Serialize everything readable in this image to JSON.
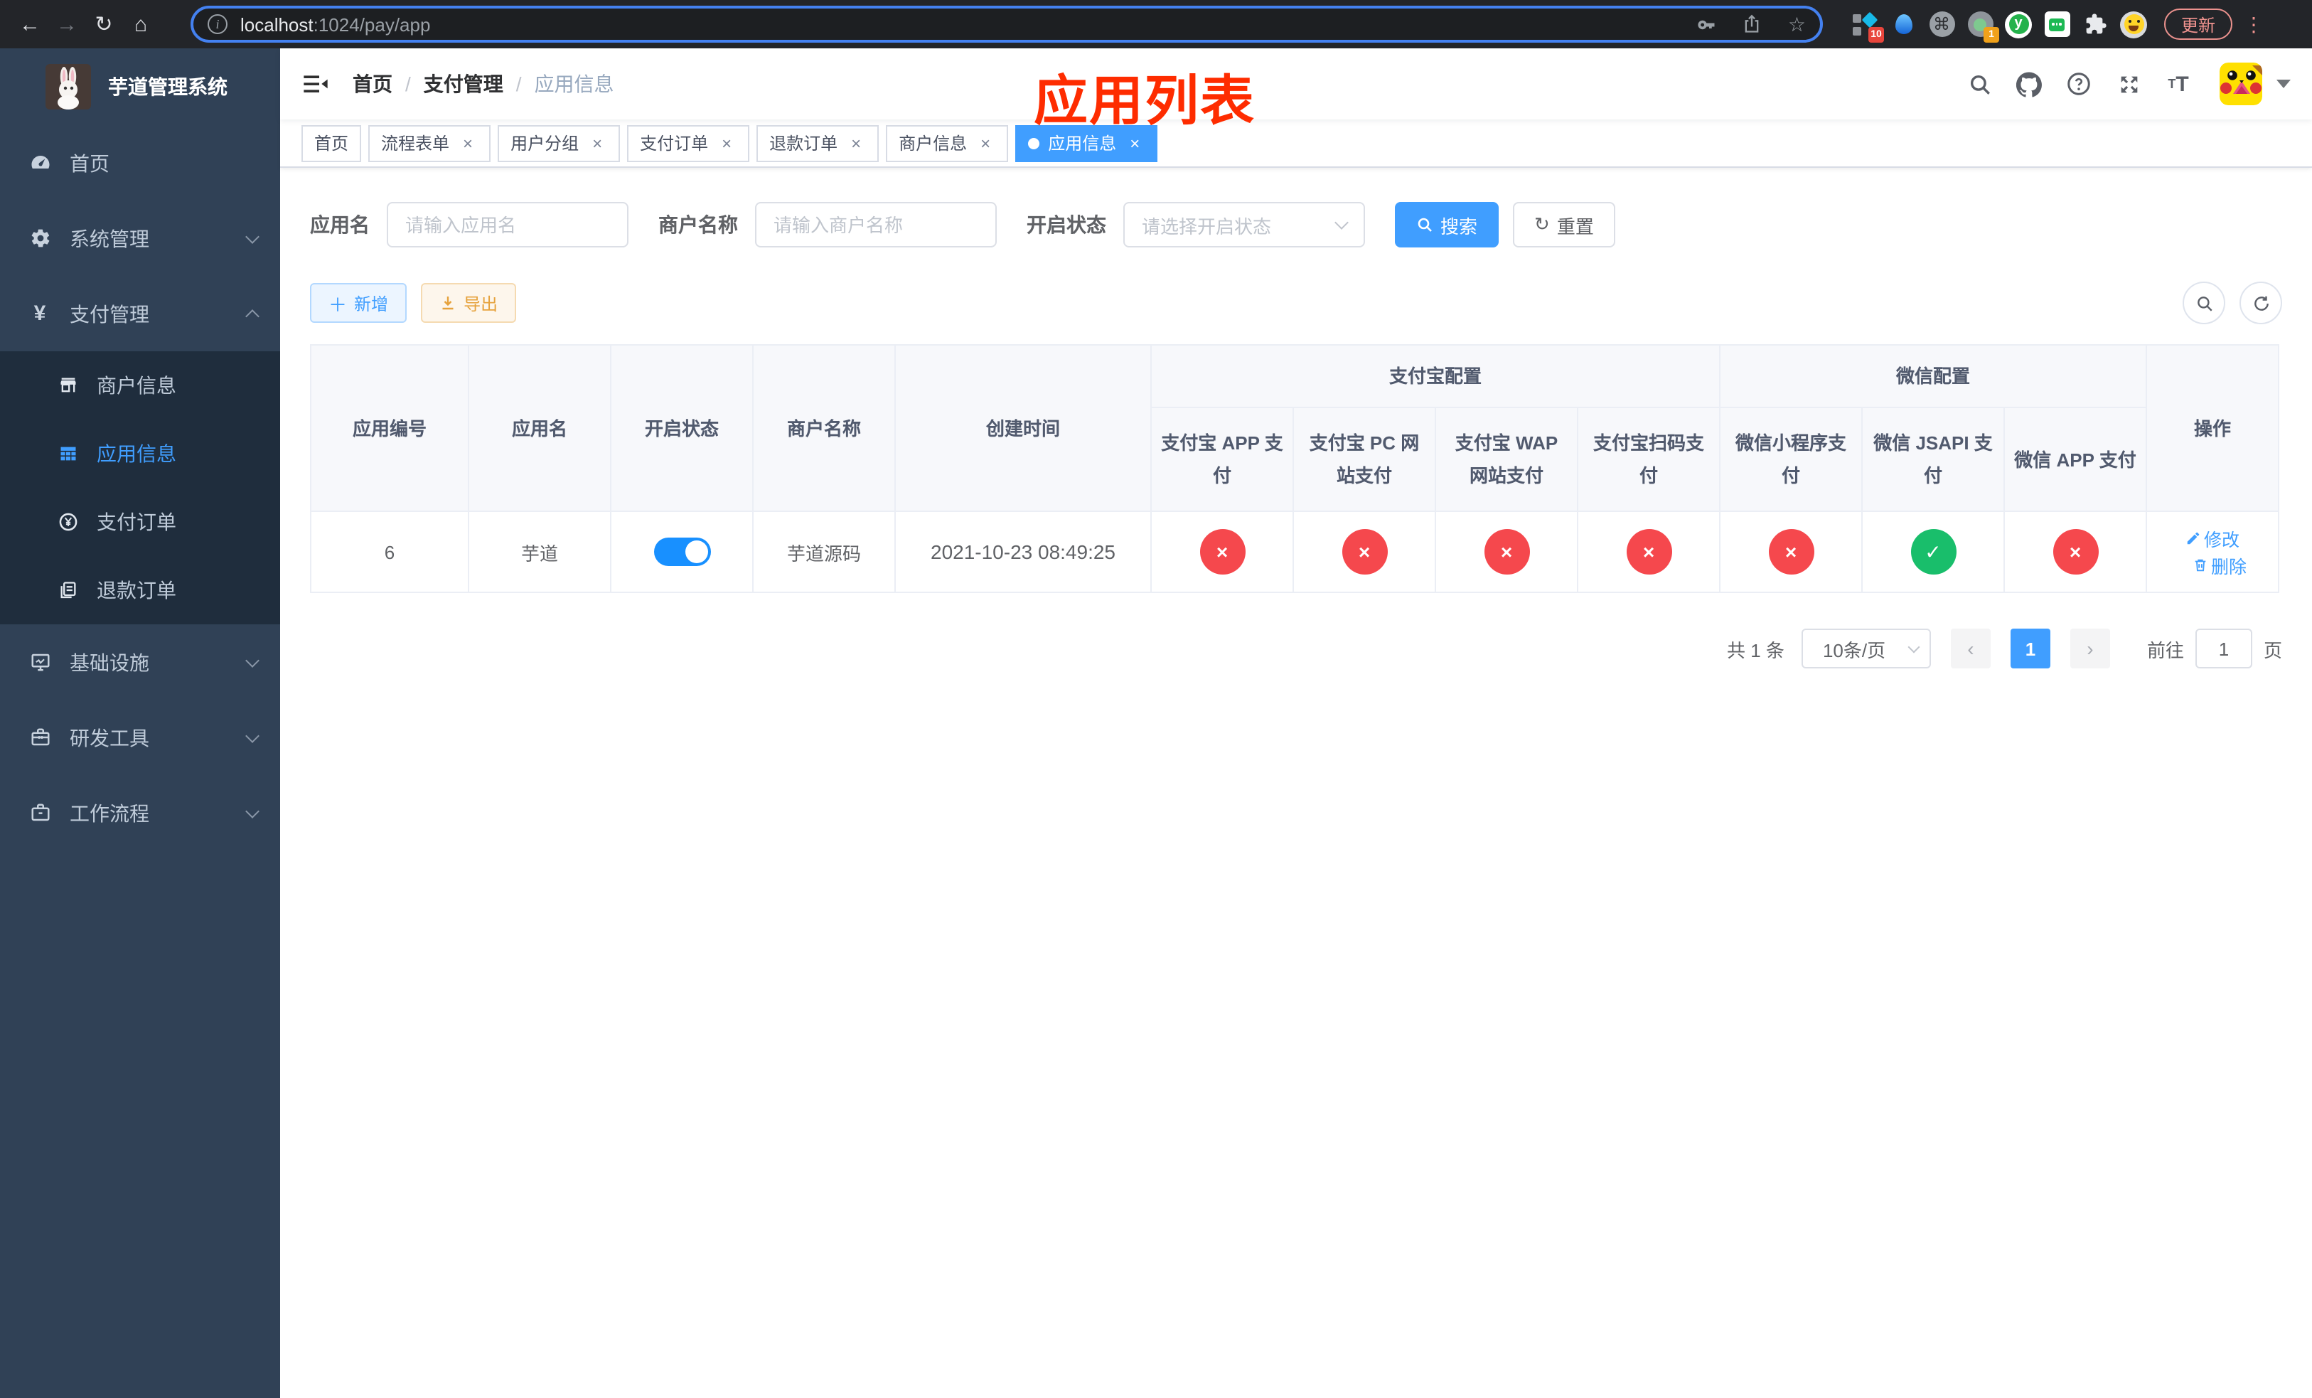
{
  "colors": {
    "primary": "#409eff",
    "switch": "#1890ff",
    "success": "#19be6b",
    "danger": "#f5484d",
    "warning": "#e6a23c",
    "annotation": "#fe2c00",
    "sidebar": "#304156",
    "submenu": "#1f2d3d"
  },
  "icons": {
    "back": "←",
    "forward": "→",
    "reload": "↻",
    "home": "⌂",
    "star": "☆",
    "command": "⌘",
    "overflow": "⋮",
    "close": "×",
    "check": "✓",
    "cross": "×",
    "prev": "‹",
    "next": "›",
    "yen": "¥",
    "font_small": "T",
    "font_big": "T",
    "reset": "↻",
    "plus": "＋",
    "info": "i"
  },
  "browser": {
    "url": {
      "host": "localhost",
      "path": ":1024/pay/app"
    },
    "update_label": "更新",
    "ext_badge_design": "10",
    "ext_badge_lens": "1",
    "ext_y_label": "y"
  },
  "sidebar": {
    "logo_title": "芋道管理系统",
    "items": [
      {
        "label": "首页"
      },
      {
        "label": "系统管理"
      },
      {
        "label": "支付管理"
      }
    ],
    "submenu": [
      {
        "label": "商户信息"
      },
      {
        "label": "应用信息",
        "active": true
      },
      {
        "label": "支付订单"
      },
      {
        "label": "退款订单"
      }
    ],
    "items2": [
      {
        "label": "基础设施"
      },
      {
        "label": "研发工具"
      },
      {
        "label": "工作流程"
      }
    ]
  },
  "navbar": {
    "breadcrumb": [
      "首页",
      "支付管理",
      "应用信息"
    ],
    "separator": "/"
  },
  "annotation": {
    "text": "应用列表"
  },
  "tabs": [
    {
      "label": "首页",
      "closable": false,
      "active": false
    },
    {
      "label": "流程表单",
      "closable": true,
      "active": false
    },
    {
      "label": "用户分组",
      "closable": true,
      "active": false
    },
    {
      "label": "支付订单",
      "closable": true,
      "active": false
    },
    {
      "label": "退款订单",
      "closable": true,
      "active": false
    },
    {
      "label": "商户信息",
      "closable": true,
      "active": false
    },
    {
      "label": "应用信息",
      "closable": true,
      "active": true
    }
  ],
  "filters": {
    "app_name": {
      "label": "应用名",
      "placeholder": "请输入应用名"
    },
    "merchant_name": {
      "label": "商户名称",
      "placeholder": "请输入商户名称"
    },
    "status": {
      "label": "开启状态",
      "placeholder": "请选择开启状态"
    },
    "search_label": "搜索",
    "reset_label": "重置"
  },
  "toolbar": {
    "add_label": "新增",
    "export_label": "导出"
  },
  "table": {
    "columns": {
      "app_id": "应用编号",
      "app_name": "应用名",
      "status": "开启状态",
      "merchant": "商户名称",
      "created": "创建时间",
      "ops": "操作"
    },
    "groups": {
      "alipay": "支付宝配置",
      "wechat": "微信配置"
    },
    "sub_columns": [
      "支付宝 APP 支付",
      "支付宝 PC 网站支付",
      "支付宝 WAP 网站支付",
      "支付宝扫码支付",
      "微信小程序支付",
      "微信 JSAPI 支付",
      "微信 APP 支付"
    ],
    "rows": [
      {
        "app_id": "6",
        "app_name": "芋道",
        "enabled": true,
        "merchant": "芋道源码",
        "created": "2021-10-23 08:49:25",
        "pay_channels": [
          "fail",
          "fail",
          "fail",
          "fail",
          "fail",
          "success",
          "fail"
        ],
        "edit_label": "修改",
        "delete_label": "删除"
      }
    ]
  },
  "pagination": {
    "total": "共 1 条",
    "page_size": "10条/页",
    "page": "1",
    "goto_label": "前往",
    "goto_value": "1",
    "unit_label": "页"
  }
}
